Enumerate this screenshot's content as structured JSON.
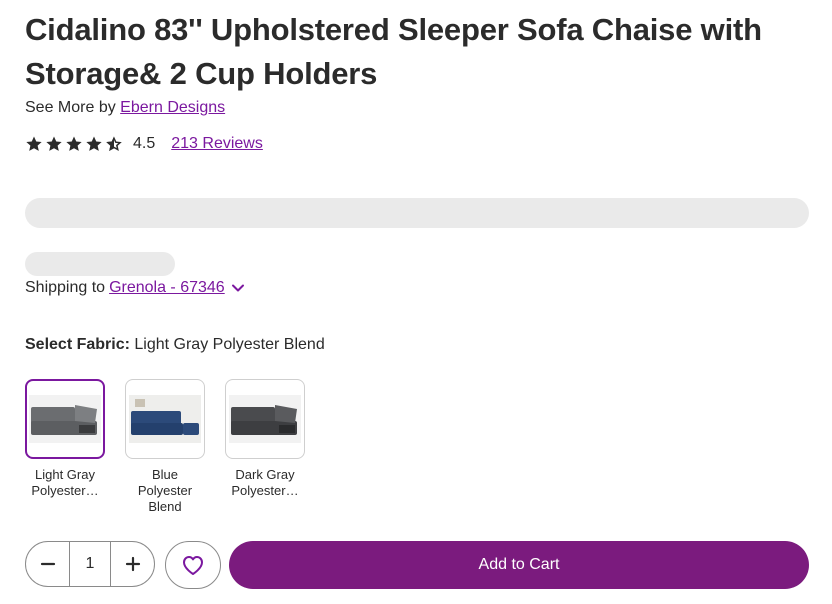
{
  "product": {
    "title": "Cidalino 83'' Upholstered Sleeper Sofa Chaise with Storage& 2 Cup Holders",
    "see_more_prefix": "See More by",
    "brand": "Ebern Designs",
    "rating": "4.5",
    "rating_stars": 4.5,
    "reviews": "213 Reviews"
  },
  "shipping": {
    "prefix": "Shipping to",
    "location": "Grenola - 67346"
  },
  "fabric": {
    "label": "Select Fabric:",
    "selected": "Light Gray Polyester Blend",
    "options": [
      {
        "name": "Light Gray Polyester…",
        "color": "#6b6d70"
      },
      {
        "name": "Blue Polyester Blend",
        "color": "#2c4a7a"
      },
      {
        "name": "Dark Gray Polyester…",
        "color": "#4a4b4e"
      }
    ]
  },
  "quantity": {
    "value": "1"
  },
  "actions": {
    "add_to_cart": "Add to Cart"
  },
  "colors": {
    "accent": "#7b189f",
    "cart_button": "#7b1b7e"
  }
}
